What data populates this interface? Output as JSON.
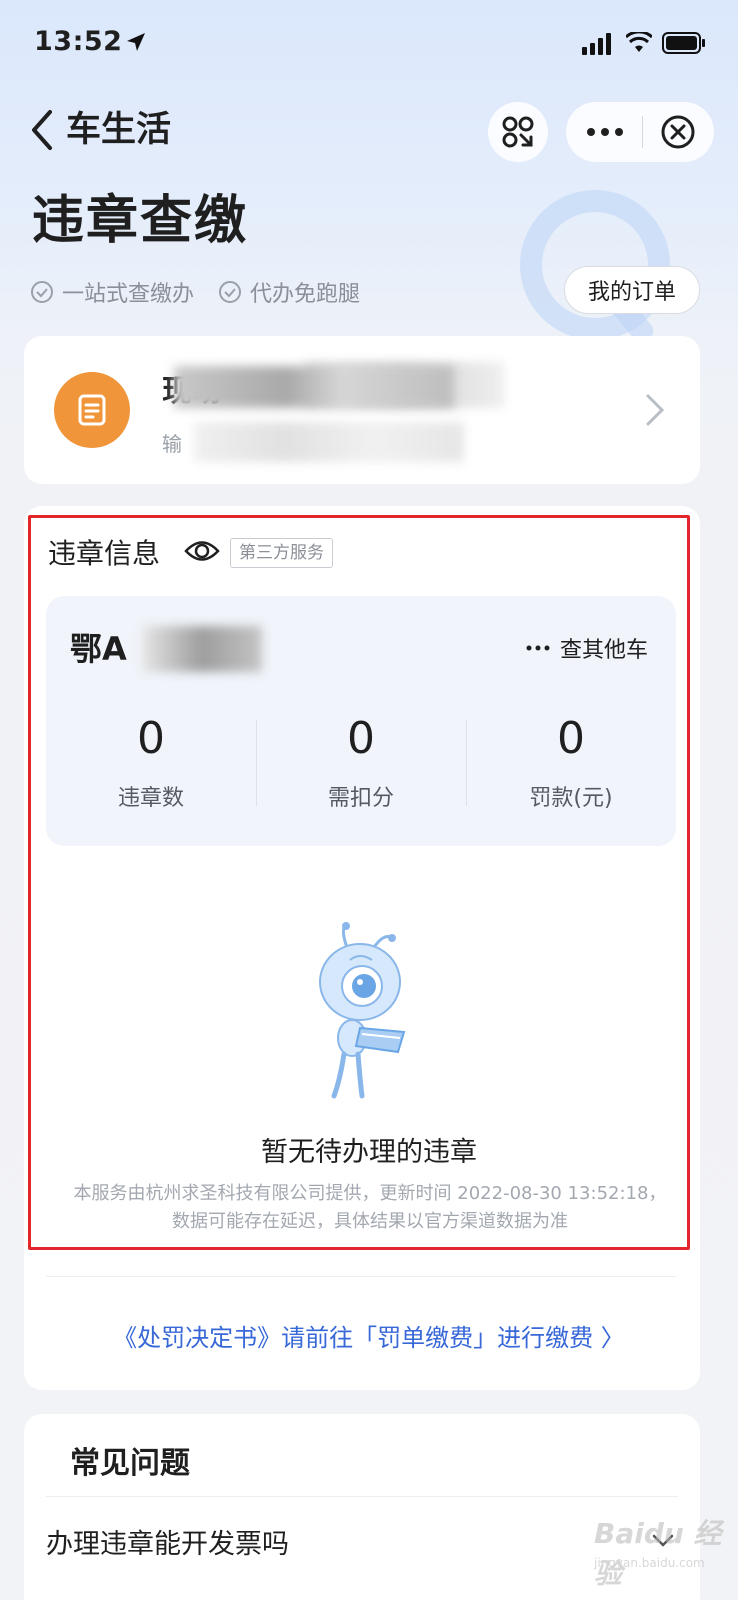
{
  "status_bar": {
    "time": "13:52"
  },
  "nav": {
    "back_title": "车生活"
  },
  "hero": {
    "title": "违章查缴",
    "features": [
      "一站式查缴办",
      "代办免跑腿"
    ],
    "orders_button": "我的订单"
  },
  "ticket_card": {
    "title": "现场",
    "subtitle": "输"
  },
  "violation": {
    "section_title": "违章信息",
    "badge": "第三方服务",
    "plate": "鄂A",
    "other_car": "查其他车",
    "stats": [
      {
        "value": "0",
        "label": "违章数"
      },
      {
        "value": "0",
        "label": "需扣分"
      },
      {
        "value": "0",
        "label": "罚款(元)"
      }
    ],
    "empty_text": "暂无待办理的违章",
    "disclaimer": "本服务由杭州求圣科技有限公司提供，更新时间 2022-08-30 13:52:18，数据可能存在延迟，具体结果以官方渠道数据为准",
    "pay_link": "《处罚决定书》请前往「罚单缴费」进行缴费 〉"
  },
  "faq": {
    "title": "常见问题",
    "items": [
      "办理违章能开发票吗"
    ]
  },
  "watermark": {
    "brand": "Baidu 经验",
    "url": "jingyan.baidu.com"
  },
  "colors": {
    "accent_blue": "#3868d8",
    "orange": "#f0953a",
    "highlight_red": "#e3262b"
  }
}
